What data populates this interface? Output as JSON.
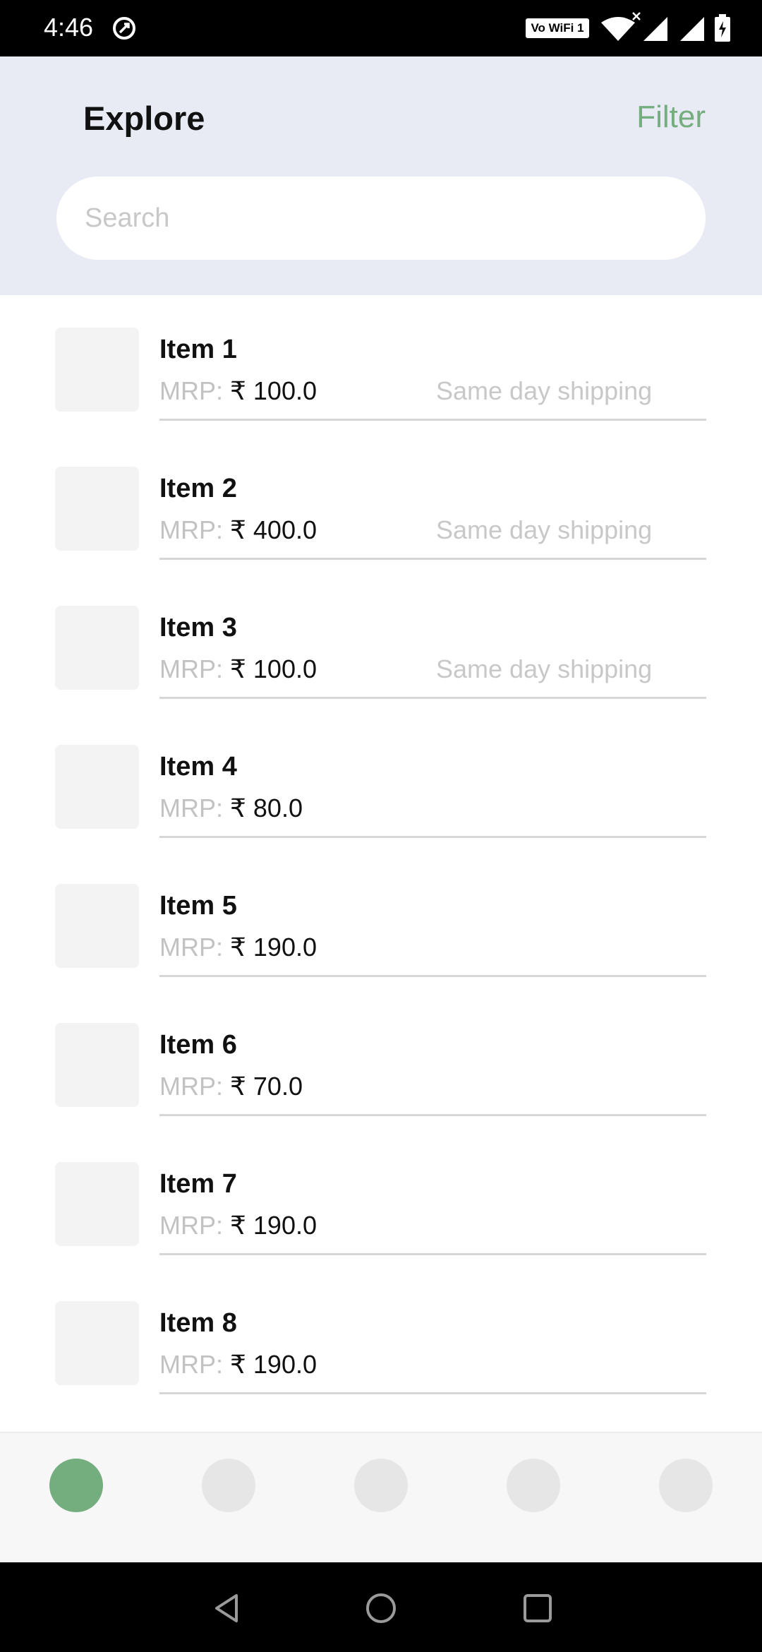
{
  "status_bar": {
    "time": "4:46",
    "wifi_label": "Vo WiFi 1",
    "icons": [
      "data-saver-icon",
      "wifi-icon",
      "signal-icon",
      "signal-icon",
      "battery-icon"
    ]
  },
  "header": {
    "title": "Explore",
    "filter_label": "Filter",
    "search_placeholder": "Search"
  },
  "colors": {
    "accent": "#74ae7e",
    "header_bg": "#e8eaf4",
    "muted_text": "#c2c2c2"
  },
  "items": [
    {
      "name": "Item 1",
      "mrp_label": "MRP:",
      "currency": "₹",
      "price": "100.0",
      "shipping": "Same day shipping"
    },
    {
      "name": "Item 2",
      "mrp_label": "MRP:",
      "currency": "₹",
      "price": "400.0",
      "shipping": "Same day shipping"
    },
    {
      "name": "Item 3",
      "mrp_label": "MRP:",
      "currency": "₹",
      "price": "100.0",
      "shipping": "Same day shipping"
    },
    {
      "name": "Item 4",
      "mrp_label": "MRP:",
      "currency": "₹",
      "price": "80.0",
      "shipping": ""
    },
    {
      "name": "Item 5",
      "mrp_label": "MRP:",
      "currency": "₹",
      "price": "190.0",
      "shipping": ""
    },
    {
      "name": "Item 6",
      "mrp_label": "MRP:",
      "currency": "₹",
      "price": "70.0",
      "shipping": ""
    },
    {
      "name": "Item 7",
      "mrp_label": "MRP:",
      "currency": "₹",
      "price": "190.0",
      "shipping": ""
    },
    {
      "name": "Item 8",
      "mrp_label": "MRP:",
      "currency": "₹",
      "price": "190.0",
      "shipping": ""
    }
  ],
  "bottom_nav": {
    "active_index": 0,
    "tabs": [
      "tab-1",
      "tab-2",
      "tab-3",
      "tab-4",
      "tab-5"
    ]
  },
  "system_nav": {
    "buttons": [
      "back-icon",
      "home-icon",
      "recents-icon"
    ]
  }
}
